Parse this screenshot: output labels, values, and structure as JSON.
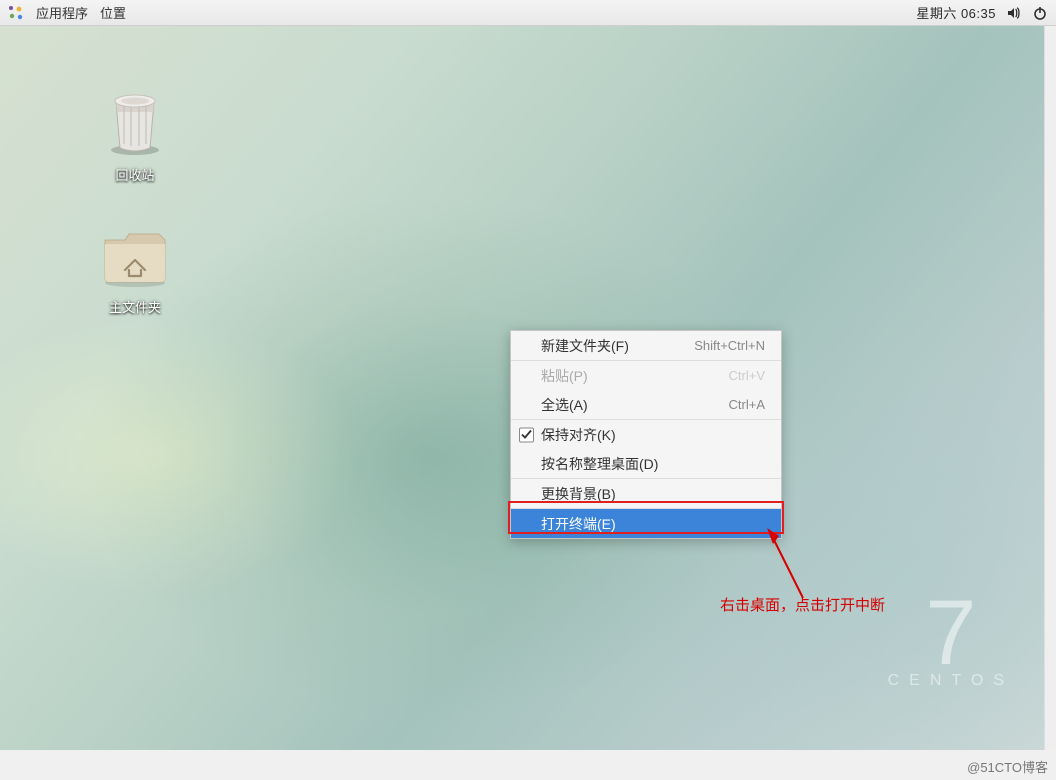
{
  "panel": {
    "apps": "应用程序",
    "places": "位置",
    "time": "星期六 06:35"
  },
  "desktop_icons": {
    "trash": "回收站",
    "home": "主文件夹"
  },
  "context_menu": {
    "new_folder": {
      "label": "新建文件夹(F)",
      "shortcut": "Shift+Ctrl+N"
    },
    "paste": {
      "label": "粘贴(P)",
      "shortcut": "Ctrl+V"
    },
    "select_all": {
      "label": "全选(A)",
      "shortcut": "Ctrl+A"
    },
    "keep_aligned": {
      "label": "保持对齐(K)"
    },
    "organize_by_name": {
      "label": "按名称整理桌面(D)"
    },
    "change_background": {
      "label": "更换背景(B)"
    },
    "open_terminal": {
      "label": "打开终端(E)"
    }
  },
  "annotation": "右击桌面，点击打开中断",
  "brand": {
    "number": "7",
    "name": "CENTOS"
  },
  "watermark": "@51CTO博客"
}
